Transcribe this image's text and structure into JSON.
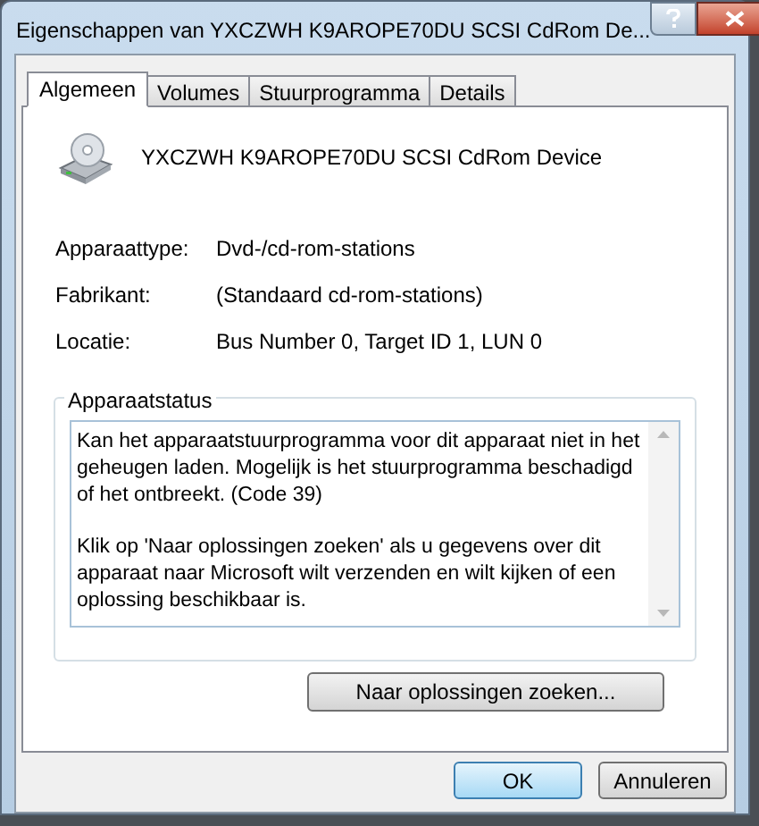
{
  "window": {
    "title": "Eigenschappen van YXCZWH K9AROPE70DU SCSI CdRom De..."
  },
  "tabs": [
    {
      "label": "Algemeen",
      "selected": true
    },
    {
      "label": "Volumes",
      "selected": false
    },
    {
      "label": "Stuurprogramma",
      "selected": false
    },
    {
      "label": "Details",
      "selected": false
    }
  ],
  "device_name": "YXCZWH K9AROPE70DU SCSI CdRom Device",
  "properties": [
    {
      "label": "Apparaattype:",
      "value": "Dvd-/cd-rom-stations"
    },
    {
      "label": "Fabrikant:",
      "value": "(Standaard cd-rom-stations)"
    },
    {
      "label": "Locatie:",
      "value": "Bus Number 0, Target ID 1, LUN 0"
    }
  ],
  "device_status": {
    "title": "Apparaatstatus",
    "paragraphs": [
      "Kan het apparaatstuurprogramma voor dit apparaat niet in het geheugen laden. Mogelijk is het stuurprogramma beschadigd of het ontbreekt. (Code 39)",
      "Klik op 'Naar oplossingen zoeken' als u gegevens over dit apparaat naar Microsoft wilt verzenden en wilt kijken of een oplossing beschikbaar is."
    ],
    "button": "Naar oplossingen zoeken..."
  },
  "buttons": [
    {
      "label": "OK",
      "default": true
    },
    {
      "label": "Annuleren",
      "default": false
    }
  ]
}
